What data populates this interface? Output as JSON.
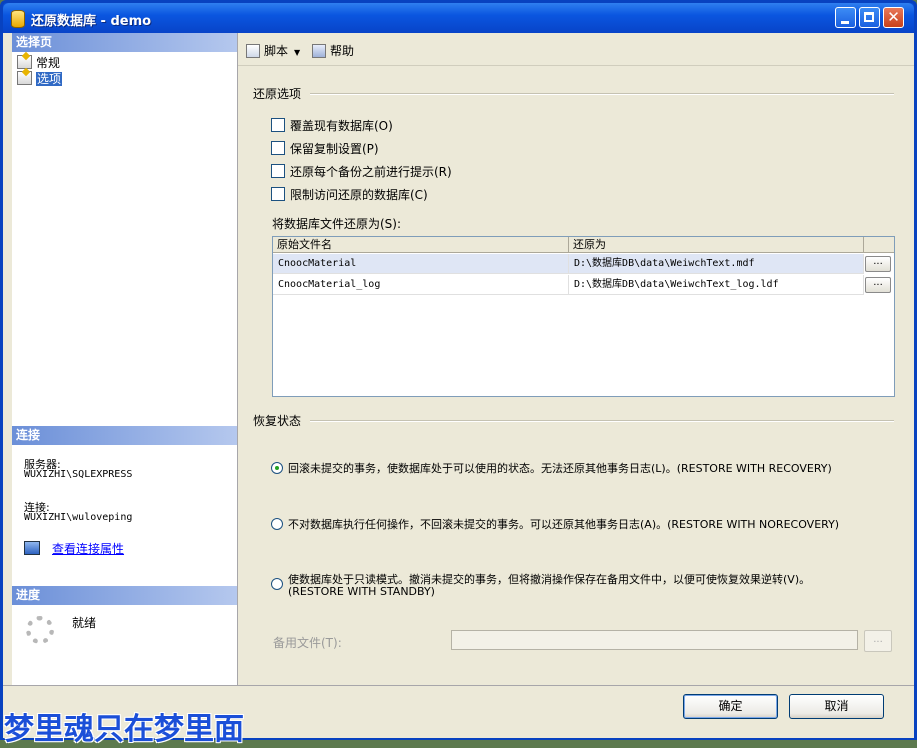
{
  "window": {
    "title": "还原数据库 - demo"
  },
  "left": {
    "select_page_header": "选择页",
    "pages": [
      {
        "label": "常规",
        "selected": false
      },
      {
        "label": "选项",
        "selected": true
      }
    ],
    "connection_header": "连接",
    "server_label": "服务器:",
    "server_value": "WUXIZHI\\SQLEXPRESS",
    "connection_label": "连接:",
    "connection_value": "WUXIZHI\\wuloveping",
    "view_connection_link": "查看连接属性",
    "progress_header": "进度",
    "progress_status": "就绪"
  },
  "toolbar": {
    "script_label": "脚本",
    "help_label": "帮助"
  },
  "restore_options": {
    "title": "还原选项",
    "checkboxes": [
      {
        "label": "覆盖现有数据库(O)",
        "checked": false
      },
      {
        "label": "保留复制设置(P)",
        "checked": false
      },
      {
        "label": "还原每个备份之前进行提示(R)",
        "checked": false
      },
      {
        "label": "限制访问还原的数据库(C)",
        "checked": false
      }
    ],
    "restore_as_label": "将数据库文件还原为(S):"
  },
  "grid": {
    "headers": [
      "原始文件名",
      "还原为"
    ],
    "rows": [
      {
        "original": "CnoocMaterial",
        "restore_as": "D:\\数据库DB\\data\\WeiwchText.mdf",
        "button": "...",
        "selected": true
      },
      {
        "original": "CnoocMaterial_log",
        "restore_as": "D:\\数据库DB\\data\\WeiwchText_log.ldf",
        "button": "...",
        "selected": false
      }
    ]
  },
  "recovery": {
    "title": "恢复状态",
    "options": [
      {
        "line1": "回滚未提交的事务，使数据库处于可以使用的状态。无法还原其他事务日志(L)。(RESTORE WITH RECOVERY)",
        "line2": "",
        "selected": true
      },
      {
        "line1": "不对数据库执行任何操作，不回滚未提交的事务。可以还原其他事务日志(A)。(RESTORE WITH NORECOVERY)",
        "line2": "",
        "selected": false
      },
      {
        "line1": "使数据库处于只读模式。撤消未提交的事务，但将撤消操作保存在备用文件中，以便可使恢复效果逆转(V)。",
        "line2": "(RESTORE WITH STANDBY)",
        "selected": false
      }
    ],
    "standby_file_label": "备用文件(T):",
    "standby_file_value": "",
    "browse_button": "..."
  },
  "buttons": {
    "ok": "确定",
    "cancel": "取消"
  },
  "watermark": "梦里魂只在梦里面"
}
